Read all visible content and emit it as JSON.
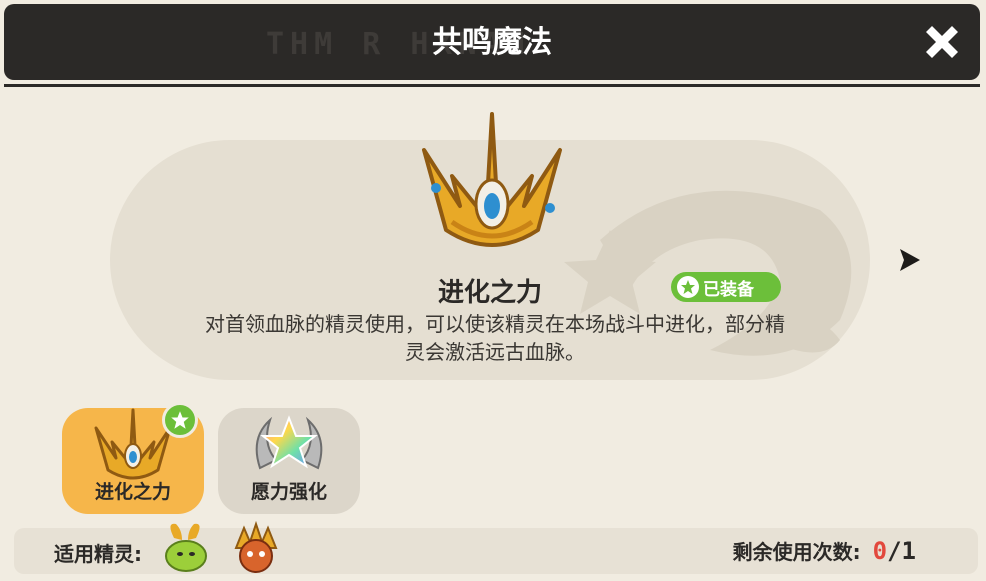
{
  "header": {
    "deco_text": "THM R HXNAN",
    "title": "共鸣魔法"
  },
  "item": {
    "name": "进化之力",
    "badge": "已装备",
    "description": "对首领血脉的精灵使用，可以使该精灵在本场战斗中进化，部分精灵会激活远古血脉。"
  },
  "slots": [
    {
      "label": "进化之力",
      "selected": true,
      "equipped": true
    },
    {
      "label": "愿力强化",
      "selected": false,
      "equipped": false
    }
  ],
  "footer": {
    "applicable_label": "适用精灵:",
    "remaining_label": "剩余使用次数:",
    "remaining_current": "0",
    "remaining_total": "/1"
  },
  "colors": {
    "titlebar": "#2b2927",
    "selected_slot": "#f6b64a",
    "badge_green": "#6cbf3a",
    "uses_red": "#e2483d"
  },
  "icons": [
    "close-icon",
    "crown-icon",
    "next-arrow-icon",
    "star-icon",
    "rainbow-star-icon"
  ]
}
